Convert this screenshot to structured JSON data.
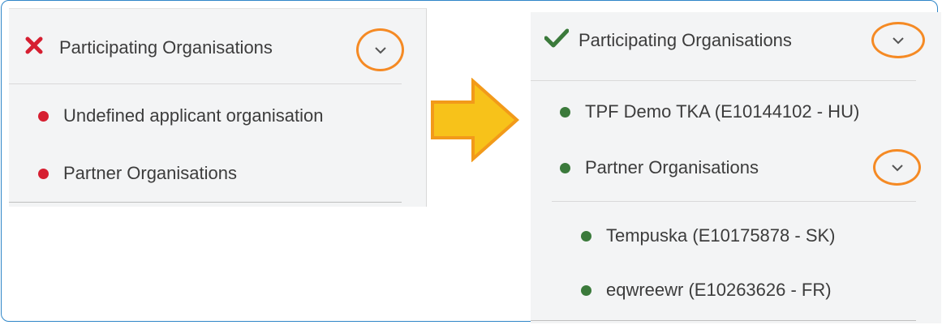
{
  "left_panel": {
    "header": {
      "label": "Participating Organisations",
      "status_icon": "x-mark-icon",
      "status_color": "#d61f31"
    },
    "items": [
      {
        "label": "Undefined applicant organisation",
        "status_color": "#d61f31"
      },
      {
        "label": "Partner Organisations",
        "status_color": "#d61f31"
      }
    ]
  },
  "right_panel": {
    "header": {
      "label": "Participating Organisations",
      "status_icon": "check-mark-icon",
      "status_color": "#3b7a3b"
    },
    "items": [
      {
        "label": "TPF Demo TKA (E10144102 - HU)",
        "status_color": "#3b7a3b"
      },
      {
        "label": "Partner Organisations",
        "status_color": "#3b7a3b"
      }
    ],
    "sub_items": [
      {
        "label": "Tempuska (E10175878 - SK)",
        "status_color": "#3b7a3b"
      },
      {
        "label": "eqwreewr (E10263626 - FR)",
        "status_color": "#3b7a3b"
      }
    ]
  },
  "annotation": {
    "arrow_icon": "right-arrow-icon",
    "arrow_color": "#f7c21a",
    "highlight_color": "#f58a24"
  }
}
